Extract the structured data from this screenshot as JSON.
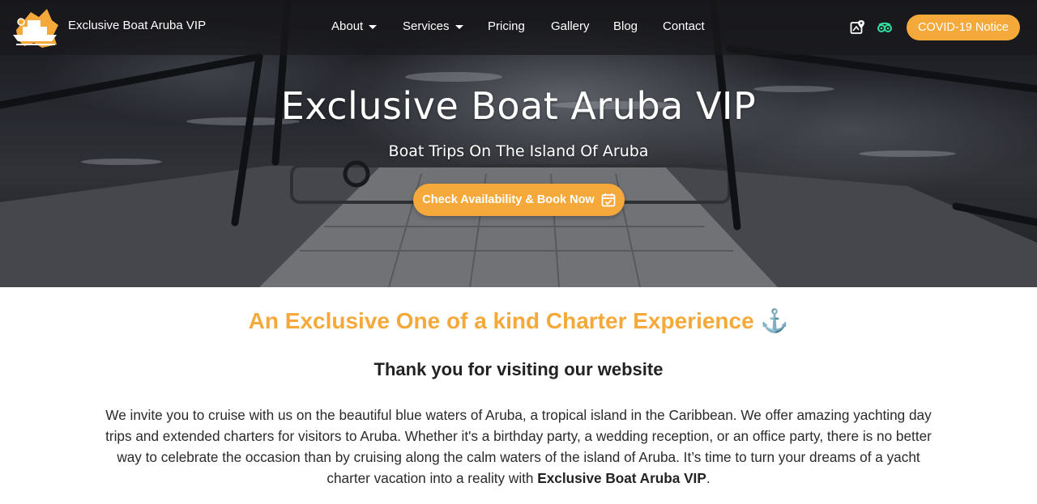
{
  "header": {
    "brand": "Exclusive Boat Aruba VIP",
    "nav": [
      {
        "label": "About",
        "dropdown": true
      },
      {
        "label": "Services",
        "dropdown": true
      },
      {
        "label": "Pricing",
        "dropdown": false
      },
      {
        "label": "Gallery",
        "dropdown": false
      },
      {
        "label": "Blog",
        "dropdown": false
      },
      {
        "label": "Contact",
        "dropdown": false
      }
    ],
    "icons": [
      "map-location-icon",
      "tripadvisor-icon"
    ],
    "covid_label": "COVID-19 Notice"
  },
  "hero": {
    "title": "Exclusive Boat Aruba VIP",
    "subtitle": "Boat Trips On The Island Of Aruba",
    "cta_label": "Check Availability & Book Now",
    "cta_icon": "calendar-check-icon"
  },
  "content": {
    "heading": "An Exclusive One of a kind Charter Experience ⚓",
    "thanks": "Thank you for visiting our website",
    "intro_text": "We invite you to cruise with us on the beautiful blue waters of Aruba, a tropical island in the Caribbean. We offer amazing yachting day trips and extended charters for visitors to Aruba. Whether it's a birthday party, a wedding reception, or an office party, there is no better way to celebrate the occasion than by cruising along the calm waters of the island of Aruba. It’s time to turn your dreams of a yacht charter vacation into a reality with ",
    "intro_strong": "Exclusive Boat Aruba VIP",
    "intro_end": "."
  },
  "colors": {
    "accent": "#f6a93b",
    "nav_bg": "#19191c",
    "tripadvisor": "#34e0a1"
  }
}
